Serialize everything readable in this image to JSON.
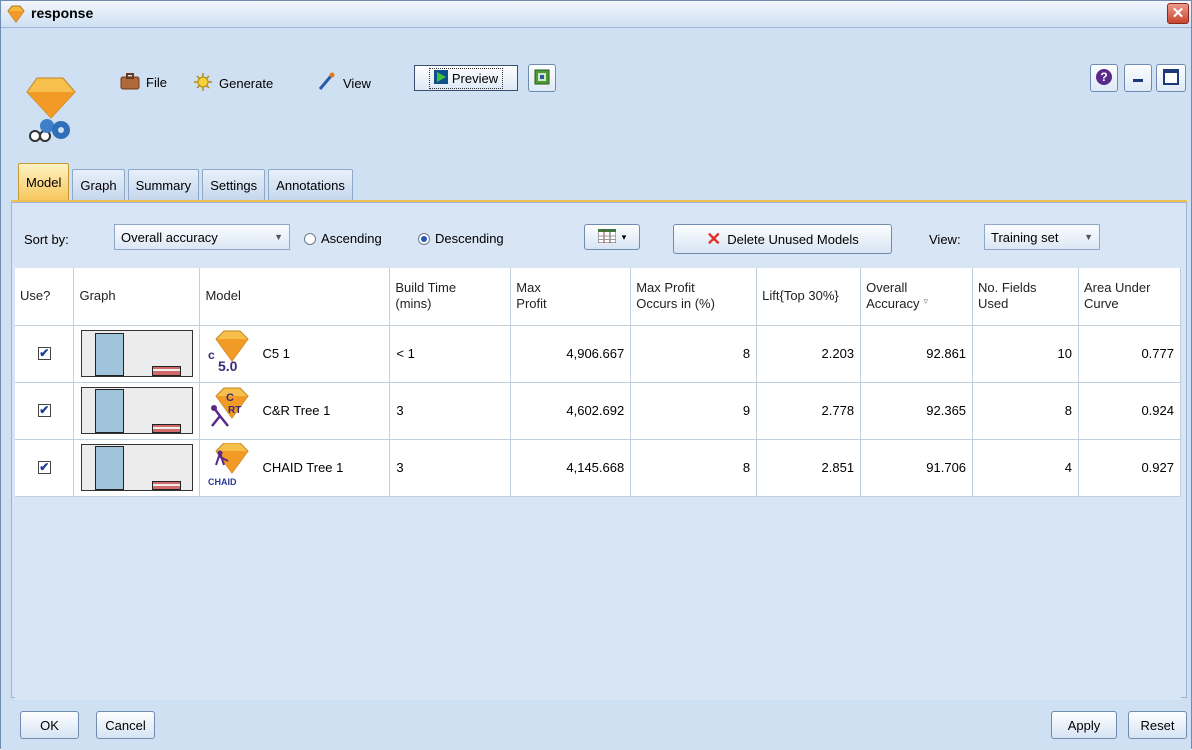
{
  "window": {
    "title": "response"
  },
  "toolbar": {
    "file_label": "File",
    "generate_label": "Generate",
    "view_label": "View",
    "preview_label": "Preview"
  },
  "tabs": [
    {
      "label": "Model",
      "active": true
    },
    {
      "label": "Graph"
    },
    {
      "label": "Summary"
    },
    {
      "label": "Settings"
    },
    {
      "label": "Annotations"
    }
  ],
  "sort": {
    "label": "Sort by:",
    "field": "Overall accuracy",
    "ascending_label": "Ascending",
    "descending_label": "Descending",
    "selected": "Descending"
  },
  "delete_label": "Delete Unused Models",
  "view": {
    "label": "View:",
    "value": "Training set"
  },
  "table": {
    "headers": [
      [
        "Use?"
      ],
      [
        "Graph"
      ],
      [
        "Model"
      ],
      [
        "Build Time",
        "(mins)"
      ],
      [
        "Max",
        "Profit"
      ],
      [
        "Max Profit",
        "Occurs in (%)"
      ],
      [
        "Lift{Top 30%}"
      ],
      [
        "Overall",
        "Accuracy"
      ],
      [
        "No. Fields",
        "Used"
      ],
      [
        "Area Under",
        "Curve"
      ]
    ],
    "rows": [
      {
        "use": true,
        "model": "C5 1",
        "icon": "c50-model-icon",
        "icon_text": "C 5.0",
        "build_time": "< 1",
        "max_profit": "4,906.667",
        "profit_occurs": "8",
        "lift": "2.203",
        "accuracy": "92.861",
        "fields": "10",
        "auc": "0.777",
        "graph": {
          "bar1": 0.95,
          "bar2": 0.22
        }
      },
      {
        "use": true,
        "model": "C&R Tree 1",
        "icon": "cr-tree-model-icon",
        "icon_text": "C&RT",
        "build_time": "3",
        "max_profit": "4,602.692",
        "profit_occurs": "9",
        "lift": "2.778",
        "accuracy": "92.365",
        "fields": "8",
        "auc": "0.924",
        "graph": {
          "bar1": 0.97,
          "bar2": 0.2
        }
      },
      {
        "use": true,
        "model": "CHAID Tree 1",
        "icon": "chaid-model-icon",
        "icon_text": "CHAID",
        "build_time": "3",
        "max_profit": "4,145.668",
        "profit_occurs": "8",
        "lift": "2.851",
        "accuracy": "91.706",
        "fields": "4",
        "auc": "0.927",
        "graph": {
          "bar1": 0.97,
          "bar2": 0.2
        }
      }
    ]
  },
  "footer": {
    "ok_label": "OK",
    "cancel_label": "Cancel",
    "apply_label": "Apply",
    "reset_label": "Reset"
  },
  "colors": {
    "window_bg": "#cfe0f3",
    "active_tab": "#f7c659",
    "bar_blue": "#9fc4dc",
    "bar_red": "#d06a6a",
    "delete_x": "#e0322a"
  }
}
